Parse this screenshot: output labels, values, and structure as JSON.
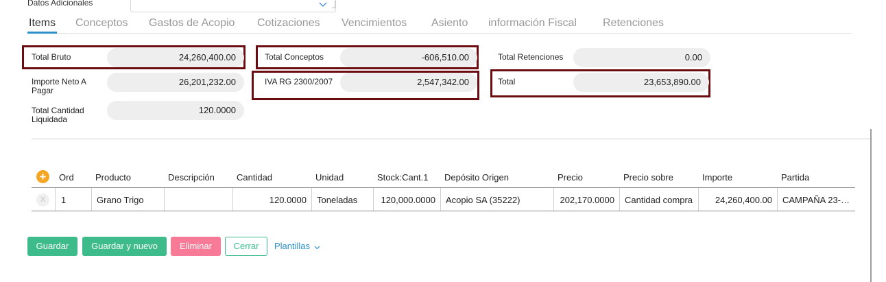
{
  "top_field": {
    "label": "Datos Adicionales"
  },
  "tabs": [
    {
      "label": "Items",
      "active": true
    },
    {
      "label": "Conceptos"
    },
    {
      "label": "Gastos de Acopio"
    },
    {
      "label": "Cotizaciones"
    },
    {
      "label": "Vencimientos"
    },
    {
      "label": "Asiento"
    },
    {
      "label": "información Fiscal"
    },
    {
      "label": "Retenciones"
    }
  ],
  "totals": {
    "total_bruto": {
      "label": "Total Bruto",
      "value": "24,260,400.00"
    },
    "importe_neto": {
      "label": "Importe Neto A Pagar",
      "value": "26,201,232.00"
    },
    "total_cantidad": {
      "label": "Total Cantidad Liquidada",
      "value": "120.0000"
    },
    "total_conceptos": {
      "label": "Total Conceptos",
      "value": "-606,510.00"
    },
    "iva": {
      "label": "IVA RG 2300/2007",
      "value": "2,547,342.00"
    },
    "total_retenciones": {
      "label": "Total Retenciones",
      "value": "0.00"
    },
    "total": {
      "label": "Total",
      "value": "23,653,890.00"
    }
  },
  "grid": {
    "add_icon": "+",
    "delete_icon": "X",
    "columns": [
      "Ord",
      "Producto",
      "Descripción",
      "Cantidad",
      "Unidad",
      "Stock:Cant.1",
      "Depósito Origen",
      "Precio",
      "Precio sobre",
      "Importe",
      "Partida"
    ],
    "rows": [
      {
        "ord": "1",
        "producto": "Grano Trigo",
        "descripcion": "",
        "cantidad": "120.0000",
        "unidad": "Toneladas",
        "stock": "120,000.0000",
        "deposito": "Acopio SA (35222)",
        "precio": "202,170.0000",
        "precio_sobre": "Cantidad compra",
        "importe": "24,260,400.00",
        "partida": "CAMPAÑA 23-…"
      }
    ]
  },
  "buttons": {
    "guardar": "Guardar",
    "guardar_nuevo": "Guardar y nuevo",
    "eliminar": "Eliminar",
    "cerrar": "Cerrar",
    "plantillas": "Plantillas"
  },
  "colors": {
    "highlight": "#6b0d10",
    "primary": "#3dbb8a",
    "danger": "#f77a96",
    "link": "#2b8fc9",
    "add": "#f5a623"
  }
}
